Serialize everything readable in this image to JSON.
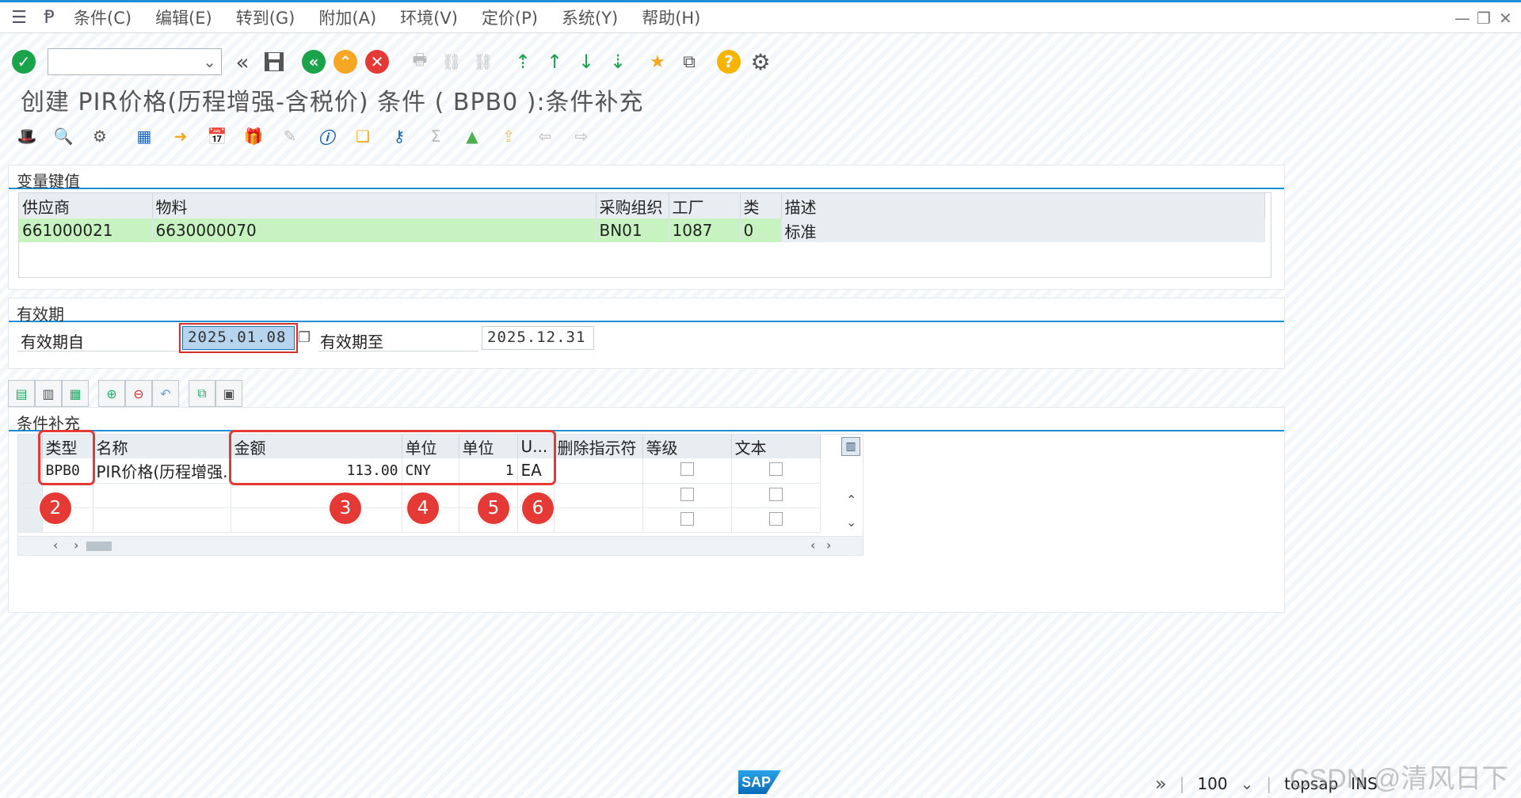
{
  "menu": {
    "items": [
      "条件(C)",
      "编辑(E)",
      "转到(G)",
      "附加(A)",
      "环境(V)",
      "定价(P)",
      "系统(Y)",
      "帮助(H)"
    ]
  },
  "window_title": "创建 PIR价格(历程增强-含税价) 条件 ( BPB0 ):条件补充",
  "variable_key": {
    "section_title": "变量键值",
    "headers": [
      "供应商",
      "物料",
      "采购组织",
      "工厂",
      "类",
      "描述"
    ],
    "row": [
      "661000021",
      "6630000070",
      "BN01",
      "1087",
      "0",
      "标准"
    ]
  },
  "validity": {
    "section_title": "有效期",
    "from_label": "有效期自",
    "from_value": "2025.01.08",
    "to_label": "有效期至",
    "to_value": "2025.12.31"
  },
  "conditions": {
    "section_title": "条件补充",
    "headers": [
      "类型",
      "名称",
      "金额",
      "单位",
      "单位",
      "U...",
      "删除指示符",
      "等级",
      "文本"
    ],
    "rows": [
      {
        "type": "BPB0",
        "name": "PIR价格(历程增强.",
        "amount": "113.00",
        "unit": "CNY",
        "per": "1",
        "uom": "EA"
      }
    ]
  },
  "annotations": [
    "2",
    "3",
    "4",
    "5",
    "6"
  ],
  "status": {
    "zoom": "100",
    "system": "topsap",
    "mode": "INS"
  },
  "watermark": "CSDN @清风日下",
  "colors": {
    "accent": "#1e8fd6",
    "key_row": "#c6f3c0",
    "annotation": "#e53935"
  }
}
